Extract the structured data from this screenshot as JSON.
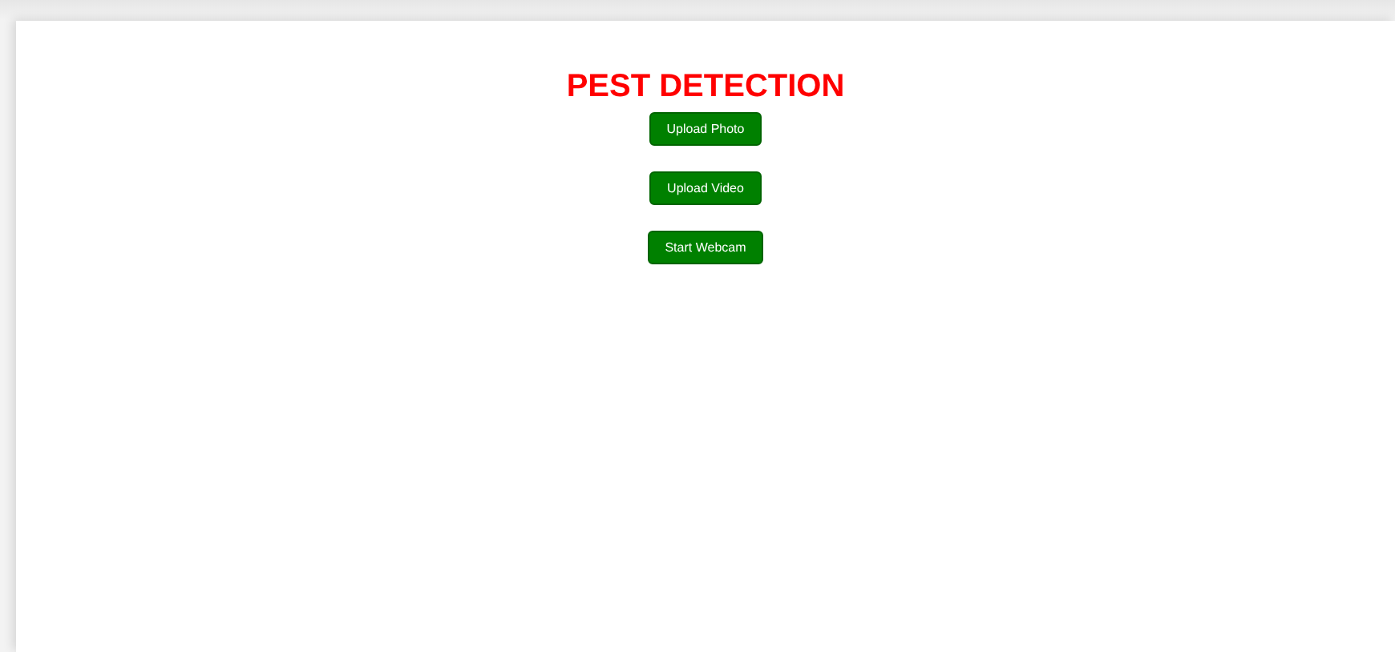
{
  "title": "PEST DETECTION",
  "buttons": [
    {
      "label": "Upload Photo"
    },
    {
      "label": "Upload Video"
    },
    {
      "label": "Start Webcam"
    }
  ]
}
